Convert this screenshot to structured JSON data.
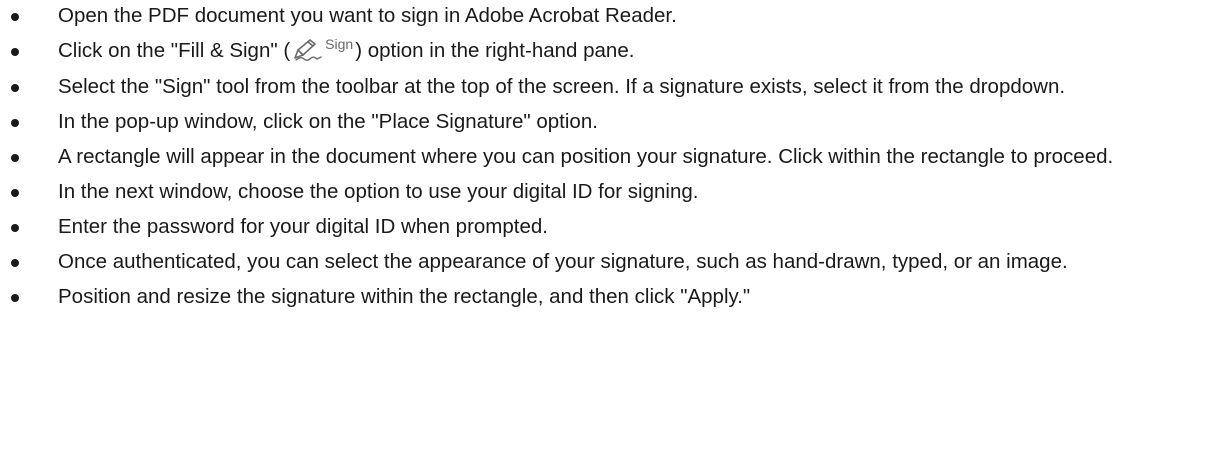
{
  "steps": [
    {
      "text": "Open the PDF document you want to sign in Adobe Acrobat Reader."
    },
    {
      "text_before": "Click on the \"Fill & Sign\" (",
      "icon": "fill-and-sign-pen-icon",
      "icon_label": "Sign",
      "text_after": ") option in the right-hand pane."
    },
    {
      "text": "Select the \"Sign\" tool from the toolbar at the top of the screen. If a signature exists, select it from the dropdown."
    },
    {
      "text": "In the pop-up window, click on the \"Place Signature\" option."
    },
    {
      "text": "A rectangle will appear in the document where you can position your signature. Click within the rectangle to proceed."
    },
    {
      "text": "In the next window, choose the option to use your digital ID for signing."
    },
    {
      "text": "Enter the password for your digital ID when prompted."
    },
    {
      "text": "Once authenticated, you can select the appearance of your signature, such as hand-drawn, typed, or an image."
    },
    {
      "text": "Position and resize the signature within the rectangle, and then click \"Apply.\""
    }
  ]
}
